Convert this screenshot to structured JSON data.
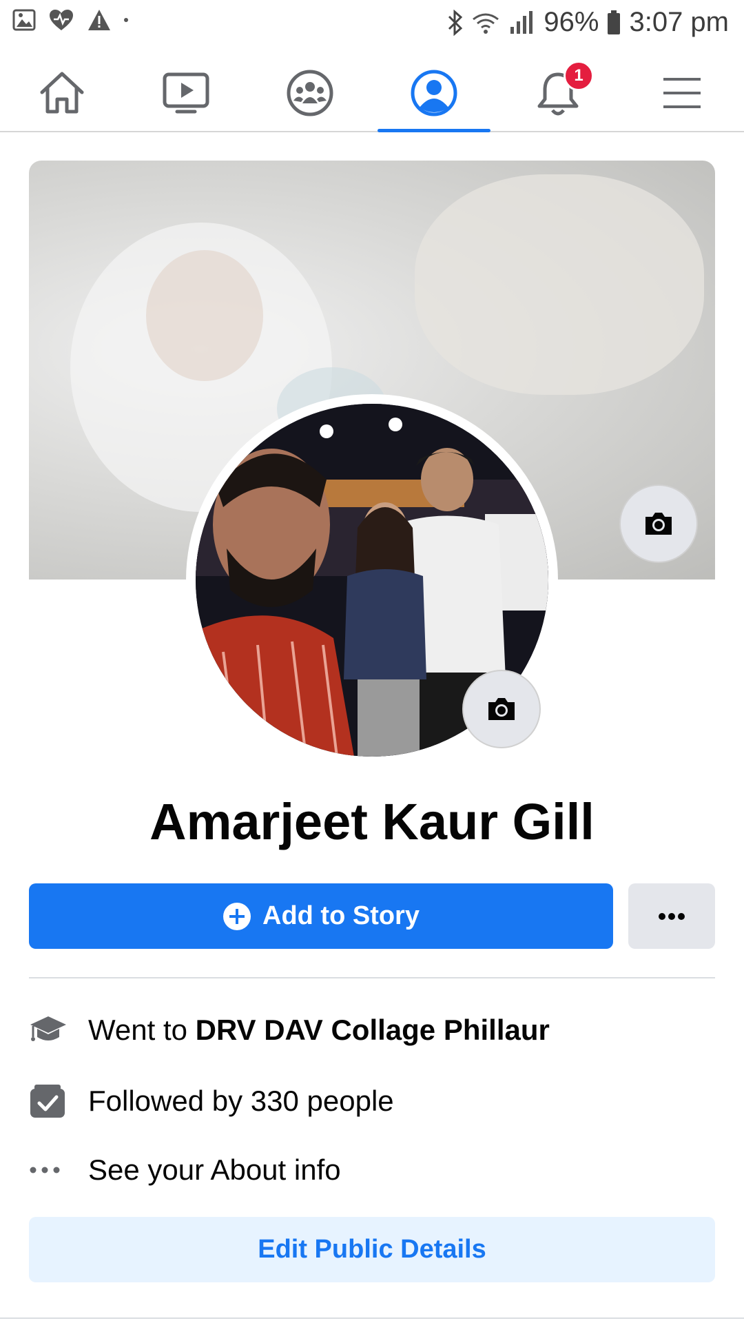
{
  "status_bar": {
    "battery": "96%",
    "time": "3:07 pm"
  },
  "nav": {
    "notification_badge": "1",
    "active_tab": "profile"
  },
  "profile": {
    "name": "Amarjeet Kaur Gill"
  },
  "actions": {
    "add_story": "Add to Story",
    "more": "•••"
  },
  "intro": {
    "education_prefix": "Went to ",
    "education_school": "DRV DAV Collage Phillaur",
    "followers": "Followed by 330 people",
    "about": "See your About info"
  },
  "edit_button": "Edit Public Details",
  "colors": {
    "brand": "#1877f2",
    "badge": "#e41e3f",
    "secondary_button": "#e4e6eb",
    "edit_button_bg": "#e7f3ff"
  }
}
